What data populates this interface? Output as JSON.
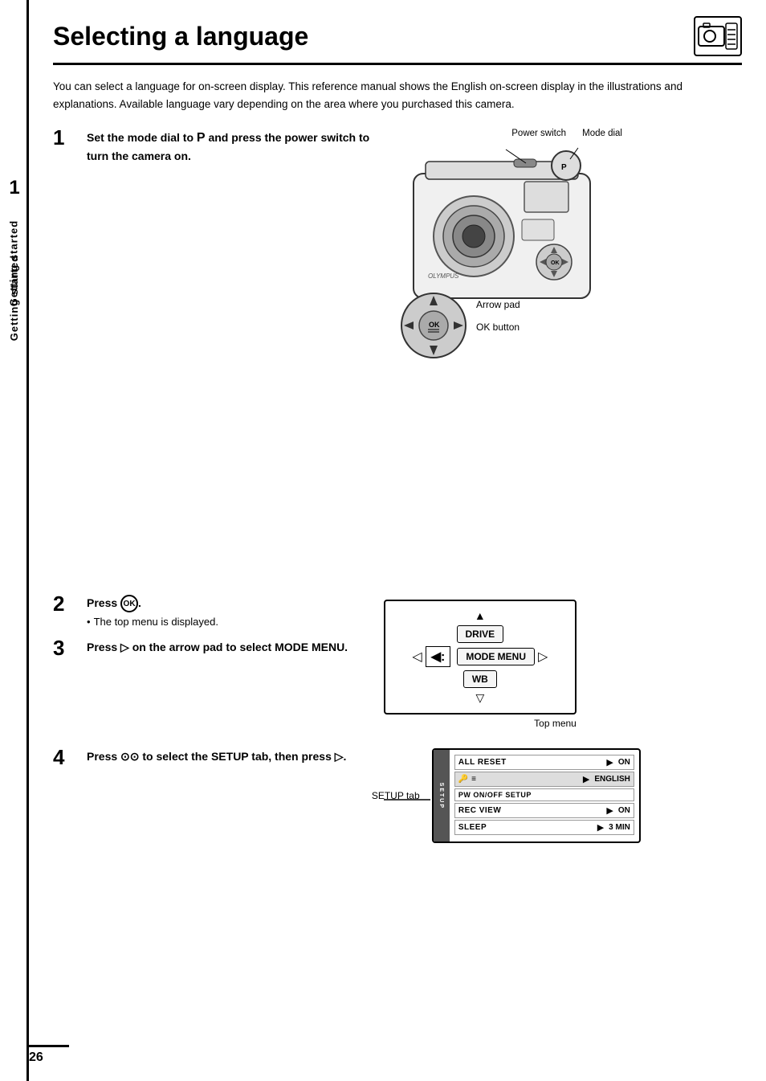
{
  "sidebar": {
    "number": "1",
    "label": "Getting started"
  },
  "title": "Selecting a language",
  "intro": "You can select a language for on-screen display. This reference manual shows the English on-screen display in the illustrations and explanations. Available language vary depending on the area where you purchased this camera.",
  "steps": [
    {
      "number": "1",
      "title": "Set the mode dial to P and press the power switch to turn the camera on.",
      "sub": null
    },
    {
      "number": "2",
      "title": "Press",
      "sub": "The top menu is displayed."
    },
    {
      "number": "3",
      "title": "Press  on the arrow pad to select MODE MENU.",
      "sub": null
    },
    {
      "number": "4",
      "title": "Press  to select the SETUP tab, then press .",
      "sub": null
    }
  ],
  "camera_labels": {
    "power_switch": "Power switch",
    "mode_dial": "Mode dial",
    "arrow_pad": "Arrow pad",
    "ok_button": "OK button"
  },
  "top_menu": {
    "label": "Top menu",
    "items": [
      "DRIVE",
      "MODE MENU",
      "WB"
    ]
  },
  "setup_menu": {
    "tab_label": "SETUP tab",
    "rows": [
      {
        "name": "ALL RESET",
        "arrow": "▶",
        "value": "ON"
      },
      {
        "name": "🔑",
        "arrow": "▶",
        "value": "ENGLISH"
      },
      {
        "name": "PW ON/OFF SETUP",
        "arrow": "",
        "value": ""
      },
      {
        "name": "REC VIEW",
        "arrow": "▶",
        "value": "ON"
      },
      {
        "name": "SLEEP",
        "arrow": "▶",
        "value": "3  MIN"
      }
    ]
  },
  "page_number": "26"
}
